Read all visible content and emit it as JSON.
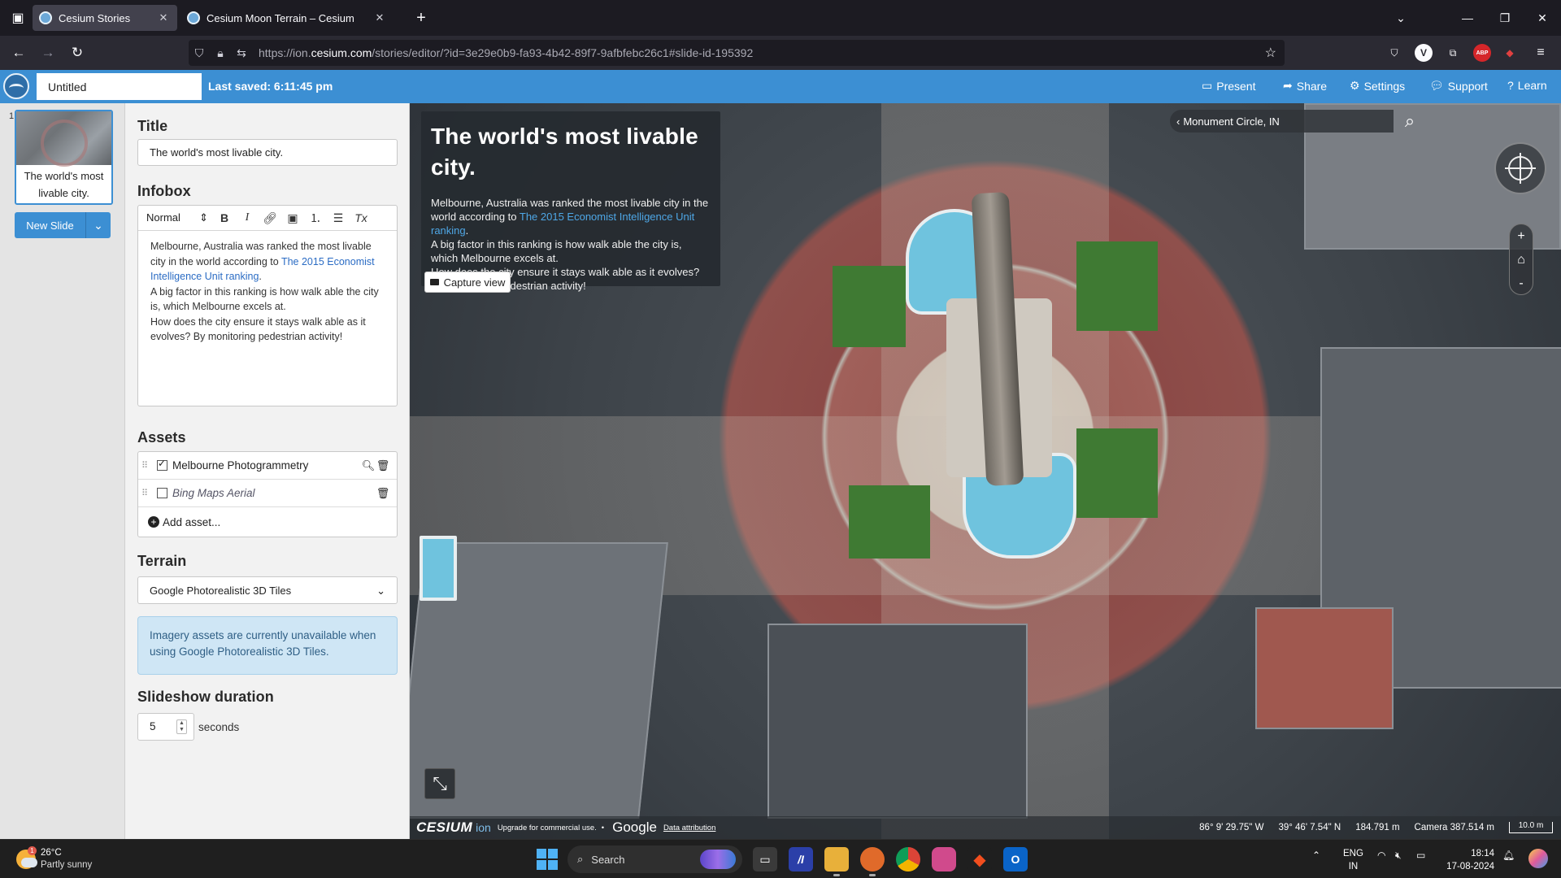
{
  "browser": {
    "tabs": [
      {
        "title": "Cesium Stories",
        "active": true
      },
      {
        "title": "Cesium Moon Terrain – Cesium",
        "active": false
      }
    ],
    "url_prefix": "https://ion.",
    "url_domain": "cesium.com",
    "url_rest": "/stories/editor/?id=3e29e0b9-fa93-4b42-89f7-9afbfebc26c1#slide-id-195392",
    "extensions": [
      "pocket-icon",
      "vpn-icon",
      "extensions-icon",
      "abp-icon",
      "shield-ext-icon"
    ],
    "extension_labels": {
      "abp": "ABP",
      "vpn": "V"
    }
  },
  "app_header": {
    "story_title": "Untitled",
    "last_saved": "Last saved: 6:11:45 pm",
    "buttons": {
      "present": "Present",
      "share": "Share",
      "settings": "Settings",
      "support": "Support",
      "learn": "Learn"
    }
  },
  "slides": {
    "items": [
      {
        "number": "1",
        "caption": "The world's most livable city."
      }
    ],
    "new_slide_label": "New Slide"
  },
  "editor": {
    "title_heading": "Title",
    "title_value": "The world's most livable city.",
    "infobox_heading": "Infobox",
    "format_select": "Normal",
    "infobox_line1": "Melbourne, Australia was ranked the most livable city in the world according to ",
    "infobox_link": "The 2015 Economist Intelligence Unit ranking",
    "infobox_line1_end": ".",
    "infobox_line2": "A big factor in this ranking is how walk able the city is, which Melbourne excels at.",
    "infobox_line3": "How does the city ensure it stays walk able as it evolves? By monitoring pedestrian activity!",
    "assets_heading": "Assets",
    "assets": [
      {
        "name": "Melbourne Photogrammetry",
        "checked": true
      },
      {
        "name": "Bing Maps Aerial",
        "checked": false
      }
    ],
    "add_asset_label": "Add asset...",
    "terrain_heading": "Terrain",
    "terrain_value": "Google Photorealistic 3D Tiles",
    "notice": "Imagery assets are currently unavailable when using Google Photorealistic 3D Tiles.",
    "duration_heading": "Slideshow duration",
    "duration_value": "5",
    "duration_unit": "seconds"
  },
  "map": {
    "infobox_title": "The world's most livable city.",
    "infobox_line1": "Melbourne, Australia was ranked the most livable city in the world according to ",
    "infobox_link": "The 2015 Economist Intelligence Unit ranking",
    "infobox_line1_end": ".",
    "infobox_line2": "A big factor in this ranking is how walk able the city is, which Melbourne excels at.",
    "infobox_line3": "How does the city ensure it stays walk able as it evolves? By monitoring pedestrian activity!",
    "capture_view_label": "Capture view",
    "geocoder_text": "Monument Circle, IN",
    "zoom_in": "+",
    "zoom_out": "-",
    "credits": {
      "cesium": "CESIUM",
      "ion": "ion",
      "upgrade": "Upgrade for commercial use.",
      "bullet": "•",
      "google": "Google",
      "attribution": "Data attribution"
    },
    "status": {
      "longitude": "86° 9' 29.75\" W",
      "latitude": "39° 46' 7.54\" N",
      "height": "184.791 m",
      "camera": "Camera 387.514 m",
      "scale": "10.0 m"
    }
  },
  "taskbar": {
    "weather_temp": "26°C",
    "weather_desc": "Partly sunny",
    "weather_badge": "1",
    "search_placeholder": "Search",
    "lang_line1": "ENG",
    "lang_line2": "IN",
    "time": "18:14",
    "date": "17-08-2024"
  },
  "colors": {
    "app_header": "#3c8fd3",
    "browser_bg": "#1c1b22",
    "link": "#2b6cc4",
    "notice_bg": "#cfe6f5"
  }
}
